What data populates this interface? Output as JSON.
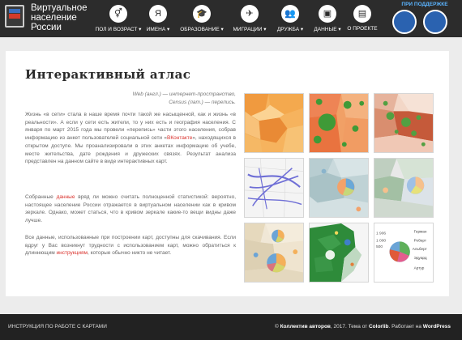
{
  "header": {
    "site_title": "Виртуальное население России",
    "nav": [
      {
        "label": "ПОЛ И ВОЗРАСТ ▾",
        "icon": "gender-icon",
        "glyph": "⚥"
      },
      {
        "label": "ИМЕНА ▾",
        "icon": "names-icon",
        "glyph": "Я"
      },
      {
        "label": "ОБРАЗОВАНИЕ ▾",
        "icon": "graduation-cap-icon",
        "glyph": "🎓"
      },
      {
        "label": "МИГРАЦИИ ▾",
        "icon": "airplane-icon",
        "glyph": "✈"
      },
      {
        "label": "ДРУЖБА ▾",
        "icon": "friends-icon",
        "glyph": "👥"
      },
      {
        "label": "ДАННЫЕ ▾",
        "icon": "data-icon",
        "glyph": "▣"
      },
      {
        "label": "О ПРОЕКТЕ",
        "icon": "info-icon",
        "glyph": "▤"
      }
    ],
    "support_label": "ПРИ ПОДДЕРЖКЕ"
  },
  "main": {
    "title": "Интерактивный атлас",
    "epigraph_1": "Web (англ.) — интернет-пространство,",
    "epigraph_2": "Census (лат.) — перепись.",
    "p1_a": "Жизнь «в сети» стала в наше время почти такой же насыщенной, как и жизнь «в реальности». А если у сети есть жители, то у них есть и география населения. С января по март 2015 года мы провели «перепись» части этого населения, собрав информацию из анкет пользователей социальной сети «",
    "p1_link": "ВКонтакте",
    "p1_b": "», находящихся в открытом доступе. Мы проанализировали в этих анкетах информацию об учебе, месте жительства, дате рождения и дружеских связях. Результат анализа представлен на данном сайте в виде интерактивных карт.",
    "p2_a": "Собранные ",
    "p2_link": "данные",
    "p2_b": " вряд ли можно считать полноценной статистикой: вероятно, настоящее население России отражается в виртуальном населении как в кривом зеркале. Однако, может статься, что в кривом зеркале какие-то вещи видны даже лучше.",
    "p3_a": "Все данные, использованные при построении карт, доступны для скачивания. Если вдруг у Вас возникнут трудности с использованием карт, можно обратиться к длиннющим ",
    "p3_link": "инструкциям",
    "p3_b": ", которые обычно никто не читает."
  },
  "thumb_legend": {
    "numbers": [
      "1 906",
      "1 000",
      "500"
    ],
    "names": [
      "Герман",
      "Роберт",
      "Альберт",
      "Эдуард",
      "Артур"
    ]
  },
  "colors": {
    "header_bg": "#2c2c2c",
    "link": "#d9302b",
    "support_text": "#5ab4ff"
  },
  "footer": {
    "left": "ИНСТРУКЦИЯ ПО РАБОТЕ С КАРТАМИ",
    "right_prefix": "© ",
    "authors": "Коллектив авторов",
    "right_mid": ", 2017. Тема от ",
    "theme_author": "Colorlib",
    "right_mid2": ". Работает на ",
    "platform": "WordPress"
  }
}
